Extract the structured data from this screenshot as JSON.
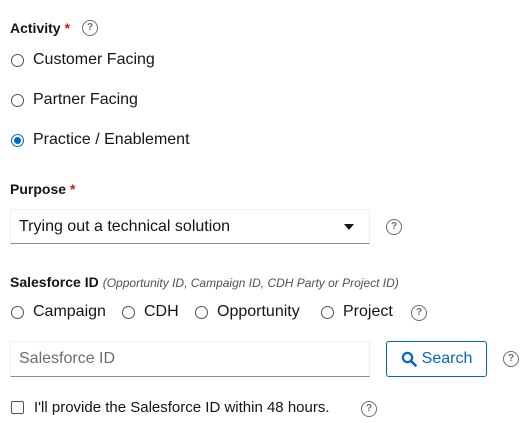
{
  "activity": {
    "label": "Activity",
    "required_mark": "*",
    "options": [
      {
        "label": "Customer Facing",
        "checked": false
      },
      {
        "label": "Partner Facing",
        "checked": false
      },
      {
        "label": "Practice / Enablement",
        "checked": true
      }
    ]
  },
  "purpose": {
    "label": "Purpose",
    "required_mark": "*",
    "selected_value": "Trying out a technical solution"
  },
  "salesforce": {
    "label": "Salesforce ID",
    "note": "(Opportunity ID, Campaign ID, CDH Party or Project ID)",
    "types": [
      {
        "label": "Campaign",
        "checked": false
      },
      {
        "label": "CDH",
        "checked": false
      },
      {
        "label": "Opportunity",
        "checked": false
      },
      {
        "label": "Project",
        "checked": false
      }
    ],
    "input_placeholder": "Salesforce ID",
    "input_value": "",
    "search_button": "Search",
    "later_checkbox_label": "I'll provide the Salesforce ID within 48 hours.",
    "later_checked": false
  },
  "colors": {
    "accent": "#0066cc",
    "required": "#c9190b",
    "help_icon": "#6a6e73"
  },
  "help_glyph": "?"
}
